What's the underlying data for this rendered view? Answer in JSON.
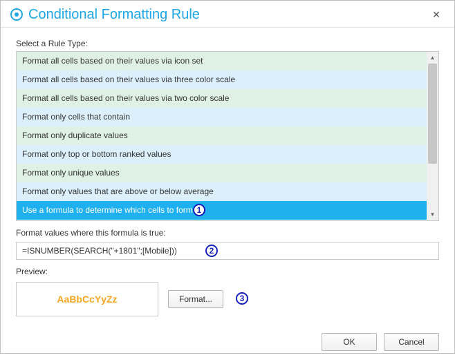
{
  "title": "Conditional Formatting Rule",
  "labels": {
    "select_rule_type": "Select a Rule Type:",
    "formula_label": "Format values where this formula is true:",
    "preview_label": "Preview:"
  },
  "rule_types": [
    "Format all cells based on their values via icon set",
    "Format all cells based on their values via three color scale",
    "Format all cells based on their values via two color scale",
    "Format only cells that contain",
    "Format only duplicate values",
    "Format only top or bottom ranked values",
    "Format only unique values",
    "Format only values that are above or below average",
    "Use a formula to determine which cells to format"
  ],
  "selected_rule_index": 8,
  "formula_value": "=ISNUMBER(SEARCH(\"+1801\";[Mobile]))",
  "preview_text": "AaBbCcYyZz",
  "buttons": {
    "format": "Format...",
    "ok": "OK",
    "cancel": "Cancel"
  },
  "markers": {
    "m1": "1",
    "m2": "2",
    "m3": "3"
  }
}
